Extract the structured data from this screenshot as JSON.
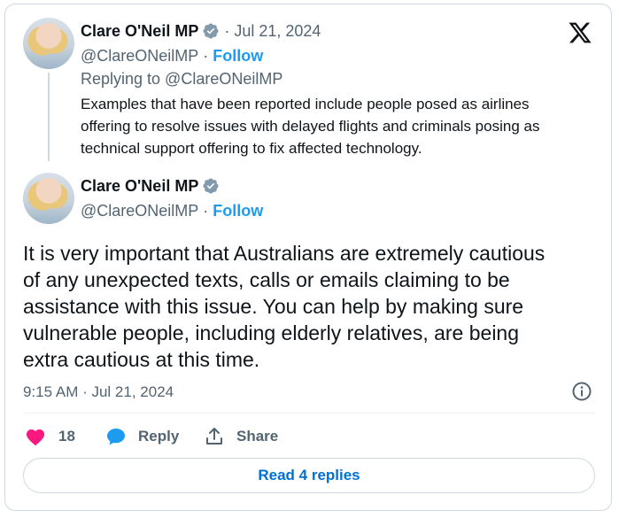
{
  "brand_icon": "x-logo-icon",
  "reply_tweet": {
    "author_name": "Clare O'Neil MP",
    "date": "· Jul 21, 2024",
    "handle": "@ClareONeilMP",
    "separator": "·",
    "follow_label": "Follow",
    "replying_to": "Replying to @ClareONeilMP",
    "text_lines": [
      "Examples that have been reported include people posed as airlines",
      "offering to resolve issues with delayed flights and criminals posing as",
      "technical support offering to fix affected technology."
    ]
  },
  "main_tweet": {
    "author_name": "Clare O'Neil MP",
    "handle": "@ClareONeilMP",
    "separator": "·",
    "follow_label": "Follow",
    "text_lines": [
      "It is very important that Australians are extremely cautious",
      "of any unexpected texts, calls or emails claiming to be",
      "assistance with this issue. You can help by making sure",
      "vulnerable people, including elderly relatives, are being",
      "extra cautious at this time."
    ],
    "timestamp": "9:15 AM · Jul 21, 2024"
  },
  "actions": {
    "like_count": "18",
    "reply_label": "Reply",
    "share_label": "Share"
  },
  "read_replies_label": "Read 4 replies",
  "colors": {
    "accent": "#1d9bf0",
    "like": "#f91880",
    "link_button": "#006fd6",
    "muted": "#536471",
    "border": "#cfd9de"
  }
}
